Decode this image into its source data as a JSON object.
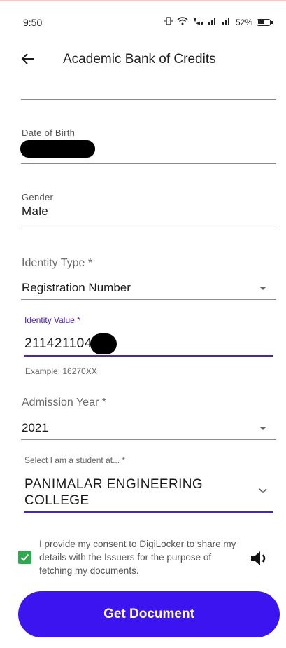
{
  "status_bar": {
    "time": "9:50",
    "battery": "52%",
    "icons": [
      "vibrate-icon",
      "wifi-icon",
      "call-icon",
      "signal-icon",
      "signal-icon",
      "battery-icon"
    ]
  },
  "header": {
    "title": "Academic Bank of Credits",
    "back_icon": "arrow-left-icon"
  },
  "form": {
    "dob_label": "Date of Birth",
    "gender_label": "Gender",
    "gender_value": "Male",
    "identity_type_label": "Identity Type *",
    "identity_type_value": "Registration Number",
    "identity_value_label": "Identity Value *",
    "identity_value": "211421104",
    "identity_hint": "Example: 16270XX",
    "admission_year_label": "Admission Year *",
    "admission_year_value": "2021",
    "college_label": "Select I am a student at... *",
    "college_value": "PANIMALAR ENGINEERING COLLEGE"
  },
  "consent": {
    "checked": true,
    "text": "I provide my consent to DigiLocker to share my details with the Issuers for the purpose of fetching my documents."
  },
  "cta": {
    "label": "Get Document"
  },
  "colors": {
    "primary": "#3b14ef",
    "focus": "#4b22c9",
    "checkbox": "#2fa84f"
  }
}
